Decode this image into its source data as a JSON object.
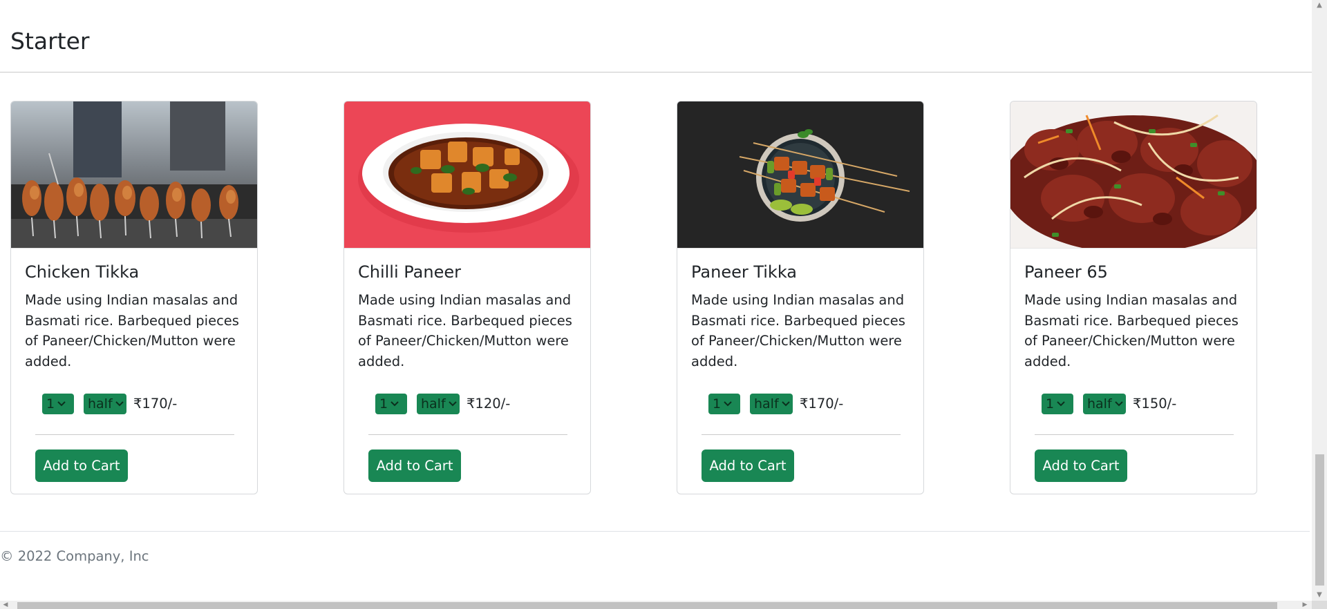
{
  "section": {
    "title": "Starter"
  },
  "cards": [
    {
      "image_icon": "chicken-tikka-image",
      "title": "Chicken Tikka",
      "description": "Made using Indian masalas and Basmati rice. Barbequed pieces of Paneer/Chicken/Mutton were added.",
      "quantity": "1",
      "size": "half",
      "price": "₹170/-",
      "button_label": "Add to Cart"
    },
    {
      "image_icon": "chilli-paneer-image",
      "title": "Chilli Paneer",
      "description": "Made using Indian masalas and Basmati rice. Barbequed pieces of Paneer/Chicken/Mutton were added.",
      "quantity": "1",
      "size": "half",
      "price": "₹120/-",
      "button_label": "Add to Cart"
    },
    {
      "image_icon": "paneer-tikka-image",
      "title": "Paneer Tikka",
      "description": "Made using Indian masalas and Basmati rice. Barbequed pieces of Paneer/Chicken/Mutton were added.",
      "quantity": "1",
      "size": "half",
      "price": "₹170/-",
      "button_label": "Add to Cart"
    },
    {
      "image_icon": "paneer-65-image",
      "title": "Paneer 65",
      "description": "Made using Indian masalas and Basmati rice. Barbequed pieces of Paneer/Chicken/Mutton were added.",
      "quantity": "1",
      "size": "half",
      "price": "₹150/-",
      "button_label": "Add to Cart"
    }
  ],
  "footer": {
    "copyright": "© 2022 Company, Inc"
  },
  "colors": {
    "accent": "#198754",
    "text": "#212529",
    "muted": "#6c757d",
    "border": "#d6d8db"
  }
}
